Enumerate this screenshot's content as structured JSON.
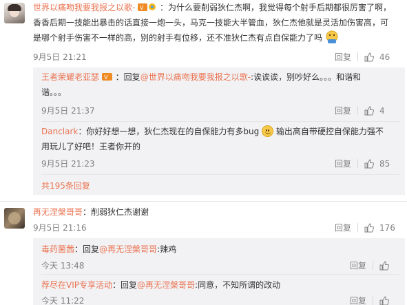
{
  "comment1": {
    "username": "世界以痛吻我要我报之以歌-",
    "text_line1": "：为什么要削弱狄仁杰啊，我觉得每个射手后期都很厉害了啊，",
    "text_line2": "香香后期一技能出暴击的话直接一炮一头，马克一技能大半管血，狄仁杰他就是灵活加伤害高，可",
    "text_line3": "是哪个射手伤害不一样的高，别的射手有位移，还不准狄仁杰有点自保能力了吗",
    "time": "9月5日 21:21",
    "reply_label": "回复",
    "like_count": "46"
  },
  "reply1": {
    "username": "王者荣耀老亚瑟",
    "text_prefix": "：回复",
    "mention": "@世界以痛吻我要我报之以歌-",
    "text_line1_rest": ":诶诶诶，别吵好么。。。和谐和",
    "text_line2": "谐。。。",
    "time": "9月5日 21:37",
    "reply_label": "回复",
    "like_count": "4"
  },
  "reply2": {
    "username": "Danclark",
    "text_line1": "：你好好想一想，狄仁杰现在的自保能力有多bug",
    "text_line1_after": "输出高自带硬控自保能力强不",
    "text_line2": "用玩儿了好吧！王者你开的",
    "time": "9月5日 21:23",
    "reply_label": "回复",
    "like_count": "85"
  },
  "more_replies": "共195条回复",
  "comment2": {
    "username": "再无涅槃哥哥",
    "text": "：削弱狄仁杰谢谢",
    "time": "9月5日 21:16",
    "reply_label": "回复",
    "like_count": "176"
  },
  "reply3": {
    "username": "毒药菌茜",
    "text_prefix": "：回复",
    "mention": "@再无涅槃哥哥",
    "text_rest": ":辣鸡",
    "time": "今天 13:48",
    "reply_label": "回复"
  },
  "reply4": {
    "username": "荐尽在VIP专享活动",
    "text_prefix": "：回复",
    "mention": "@再无涅槃哥哥",
    "text_rest": ":同意，不知所谓的改动",
    "time": "今天 11:22",
    "reply_label": "回复"
  },
  "colors": {
    "username": "#eb7350",
    "meta": "#808080",
    "reply_bg": "#f2f2f5"
  }
}
